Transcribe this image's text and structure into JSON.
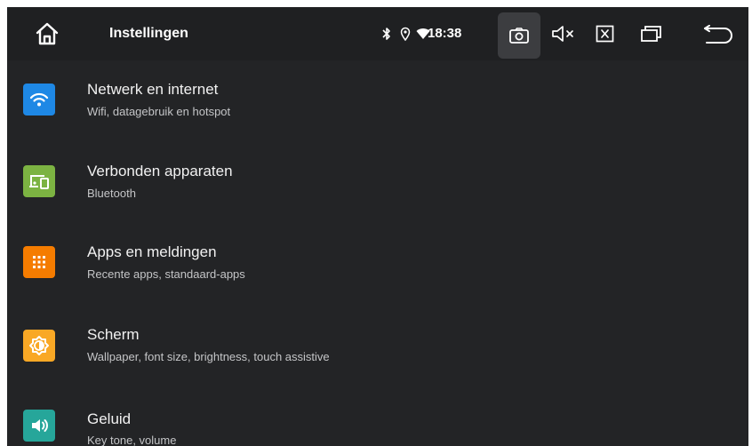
{
  "header": {
    "title": "Instellingen",
    "clock": "18:38"
  },
  "status_icons": [
    "bluetooth-icon",
    "location-icon",
    "wifi-icon"
  ],
  "controls": [
    "camera-icon",
    "volume-mute-icon",
    "close-box-icon",
    "recent-apps-icon",
    "back-icon"
  ],
  "settings": [
    {
      "title": "Netwerk en internet",
      "subtitle": "Wifi, datagebruik en hotspot",
      "icon": "wifi-icon",
      "color": "#1e88e5"
    },
    {
      "title": "Verbonden apparaten",
      "subtitle": "Bluetooth",
      "icon": "devices-icon",
      "color": "#7cb342"
    },
    {
      "title": "Apps en meldingen",
      "subtitle": "Recente apps, standaard-apps",
      "icon": "apps-grid-icon",
      "color": "#f57c00"
    },
    {
      "title": "Scherm",
      "subtitle": "Wallpaper, font size, brightness, touch assistive",
      "icon": "brightness-icon",
      "color": "#f9a825"
    },
    {
      "title": "Geluid",
      "subtitle": "Key tone, volume",
      "icon": "speaker-icon",
      "color": "#26a69a"
    }
  ]
}
